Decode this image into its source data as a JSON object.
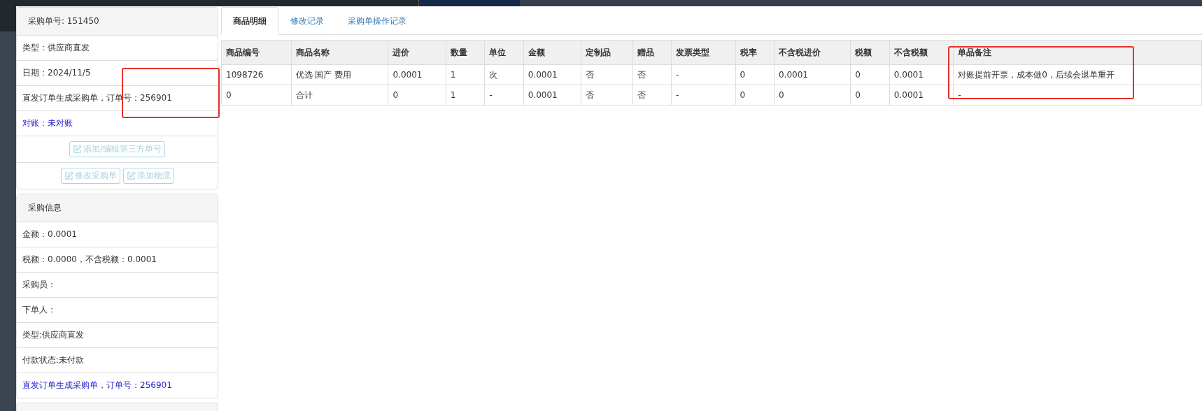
{
  "order_panel": {
    "title": "采购单号: 151450",
    "rows": [
      {
        "text": "类型：供应商直发",
        "kind": "text",
        "marked": false
      },
      {
        "text": "日期：2024/11/5",
        "kind": "text",
        "marked": false
      },
      {
        "text": "直发订单生成采购单，订单号：256901",
        "kind": "text",
        "marked": true
      },
      {
        "text": "对账：未对账",
        "kind": "link",
        "marked": false
      }
    ],
    "button_rows": [
      [
        {
          "label": "添加/编辑第三方单号",
          "disabled": true
        }
      ],
      [
        {
          "label": "修改采购单",
          "disabled": true
        },
        {
          "label": "添加物流",
          "disabled": true
        }
      ]
    ]
  },
  "purchase_panel": {
    "title": "采购信息",
    "rows": [
      {
        "text": "金额：0.0001",
        "kind": "text"
      },
      {
        "text": "税额：0.0000，不含税额：0.0001",
        "kind": "text"
      },
      {
        "text": "采购员：",
        "kind": "text"
      },
      {
        "text": "下单人：",
        "kind": "text"
      },
      {
        "text": "类型:供应商直发",
        "kind": "text"
      },
      {
        "text": "付款状态:未付款",
        "kind": "text"
      },
      {
        "text": "直发订单生成采购单，订单号：256901",
        "kind": "link"
      }
    ]
  },
  "tabs": [
    {
      "label": "商品明细",
      "selected": true
    },
    {
      "label": "修改记录",
      "selected": false
    },
    {
      "label": "采购单操作记录",
      "selected": false
    }
  ],
  "table": {
    "columns": [
      {
        "label": "商品编号",
        "marked": false
      },
      {
        "label": "商品名称",
        "marked": false
      },
      {
        "label": "进价",
        "marked": false
      },
      {
        "label": "数量",
        "marked": false
      },
      {
        "label": "单位",
        "marked": false
      },
      {
        "label": "金额",
        "marked": false
      },
      {
        "label": "定制品",
        "marked": false
      },
      {
        "label": "赠品",
        "marked": false
      },
      {
        "label": "发票类型",
        "marked": false
      },
      {
        "label": "税率",
        "marked": false
      },
      {
        "label": "不含税进价",
        "marked": false
      },
      {
        "label": "税额",
        "marked": false
      },
      {
        "label": "不含税额",
        "marked": false
      },
      {
        "label": "单品备注",
        "marked": true
      }
    ],
    "rows": [
      [
        "1098726",
        "优选 国产 费用",
        "0.0001",
        "1",
        "次",
        "0.0001",
        "否",
        "否",
        "-",
        "0",
        "0.0001",
        "0",
        "0.0001",
        "对账提前开票，成本做0，后续会退单重开"
      ],
      [
        "0",
        "合计",
        "0",
        "1",
        "-",
        "0.0001",
        "否",
        "否",
        "-",
        "0",
        "0",
        "0",
        "0.0001",
        "-"
      ]
    ]
  }
}
